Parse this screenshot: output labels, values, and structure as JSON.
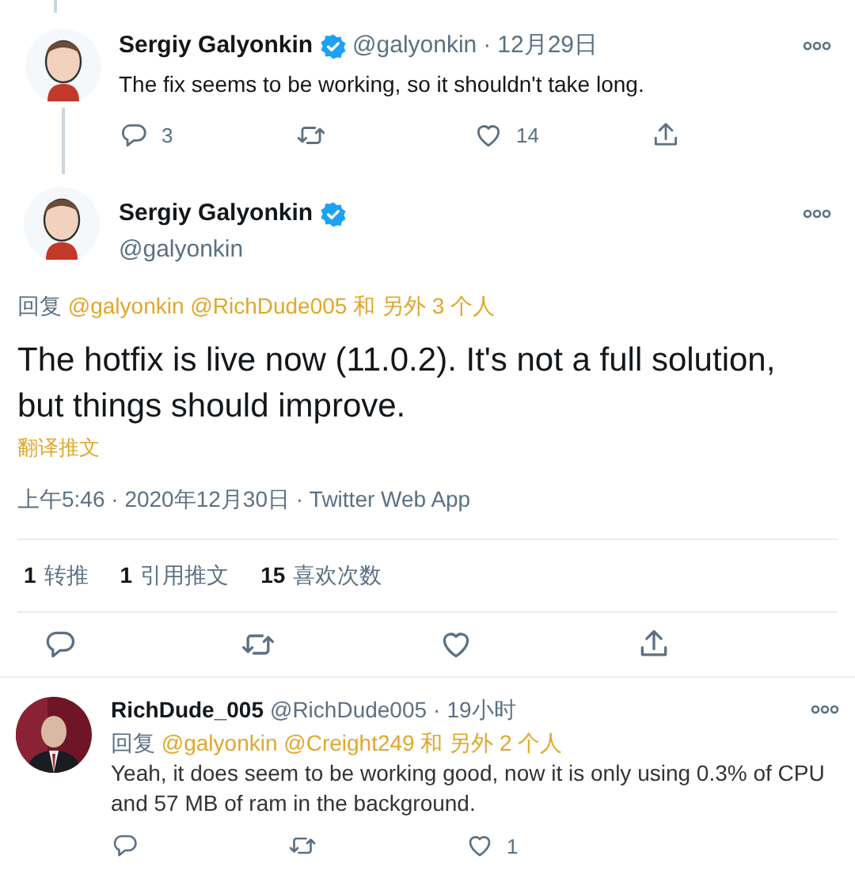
{
  "thread_tweet": {
    "name": "Sergiy Galyonkin",
    "verified": true,
    "handle": "@galyonkin",
    "separator": "·",
    "time": "12月29日",
    "text": "The fix seems to be working, so it shouldn't take long.",
    "actions": [
      {
        "kind": "reply",
        "count": "3"
      },
      {
        "kind": "retweet"
      },
      {
        "kind": "like",
        "count": "14"
      },
      {
        "kind": "share"
      }
    ]
  },
  "main_tweet": {
    "name": "Sergiy Galyonkin",
    "verified": true,
    "handle": "@galyonkin",
    "reply_label": "回复",
    "reply_mentions": "@galyonkin @RichDude005 和 另外 3 个人",
    "text": "The hotfix is live now (11.0.2). It's not a full solution, but things should improve.",
    "translate": "翻译推文",
    "meta": "上午5:46 · 2020年12月30日 · Twitter Web App",
    "stats": [
      {
        "count": "1",
        "label": "转推"
      },
      {
        "count": "1",
        "label": "引用推文"
      },
      {
        "count": "15",
        "label": "喜欢次数"
      }
    ],
    "actions": [
      {
        "kind": "reply"
      },
      {
        "kind": "retweet"
      },
      {
        "kind": "like"
      },
      {
        "kind": "share"
      }
    ]
  },
  "reply": {
    "name": "RichDude_005",
    "handle": "@RichDude005",
    "separator": "·",
    "time": "19小时",
    "reply_label": "回复",
    "reply_mentions": "@galyonkin @Creight249 和 另外 2 个人",
    "text": "Yeah, it does seem to be working good, now it is only using 0.3% of CPU and 57 MB of ram in the background.",
    "actions": [
      {
        "kind": "reply"
      },
      {
        "kind": "retweet"
      },
      {
        "kind": "like",
        "count": "1"
      }
    ]
  }
}
